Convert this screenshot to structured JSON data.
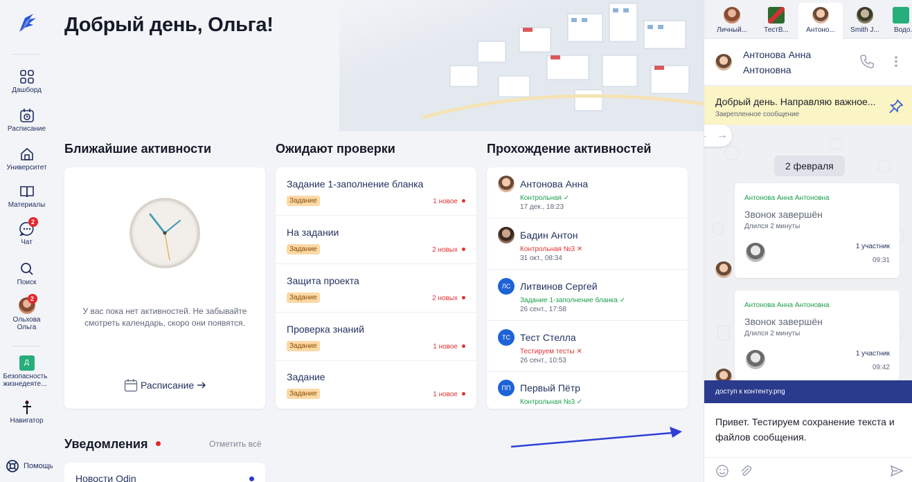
{
  "nav": {
    "items": [
      {
        "label": "Дашборд",
        "icon": "grid-icon"
      },
      {
        "label": "Расписание",
        "icon": "calendar-icon"
      },
      {
        "label": "Университет",
        "icon": "home-icon"
      },
      {
        "label": "Материалы",
        "icon": "book-icon"
      },
      {
        "label": "Чат",
        "icon": "chat-icon",
        "badge": "2"
      },
      {
        "label": "Поиск",
        "icon": "search-icon"
      },
      {
        "label": "Ольхова Ольга",
        "icon": "avatar",
        "badge": "2"
      },
      {
        "label": "Безопасность жизнедеяте...",
        "icon": "course-icon",
        "initial": "Д"
      },
      {
        "label": "Навигатор",
        "icon": "navigator-icon"
      }
    ],
    "help": "Помощь"
  },
  "greeting": "Добрый день, Ольга!",
  "activities": {
    "title": "Ближайшие активности",
    "empty": "У вас пока нет активностей. Не забывайте смотреть календарь, скоро они появятся.",
    "link": "Расписание"
  },
  "review": {
    "title": "Ожидают проверки",
    "items": [
      {
        "title": "Задание 1-заполнение бланка",
        "tag": "Задание",
        "count": "1 новое"
      },
      {
        "title": "На задании",
        "tag": "Задание",
        "count": "2 новых"
      },
      {
        "title": "Защита проекта",
        "tag": "Задание",
        "count": "2 новых"
      },
      {
        "title": "Проверка знаний",
        "tag": "Задание",
        "count": "1 новое"
      },
      {
        "title": "Задание",
        "tag": "Задание",
        "count": "1 новое"
      }
    ]
  },
  "progress": {
    "title": "Прохождение активностей",
    "items": [
      {
        "name": "Антонова Анна",
        "status": "Контрольная ✓",
        "state": "ok",
        "date": "17 дек., 18:23",
        "avatar": "photo"
      },
      {
        "name": "Бадин Антон",
        "status": "Контрольная №3 ✕",
        "state": "bad",
        "date": "31 окт., 08:34",
        "avatar": "photo2"
      },
      {
        "name": "Литвинов Сергей",
        "status": "Задание 1-заполнение бланка ✓",
        "state": "ok",
        "date": "26 сент., 17:58",
        "initials": "ЛС"
      },
      {
        "name": "Тест Стелла",
        "status": "Тестируем тесты ✕",
        "state": "bad",
        "date": "26 сент., 10:53",
        "initials": "ТС"
      },
      {
        "name": "Первый Пётр",
        "status": "Контрольная №3 ✓",
        "state": "ok",
        "date": "",
        "initials": "ПП"
      }
    ]
  },
  "notifications": {
    "title": "Уведомления",
    "mark_all": "Отметить всё",
    "items": [
      {
        "title": "Новости Odin"
      }
    ]
  },
  "chat": {
    "tabs": [
      {
        "label": "Личный..."
      },
      {
        "label": "ТестВ..."
      },
      {
        "label": "Антоно..."
      },
      {
        "label": "Smith J..."
      },
      {
        "label": "Водо..."
      }
    ],
    "contact": "Антонова Анна Антоновна",
    "pinned": {
      "text": "Добрый день. Направляю важное...",
      "sub": "Закрепленное сообщение"
    },
    "date": "2 февраля",
    "messages": [
      {
        "author": "Антонова Анна Антоновна",
        "title": "Звонок завершён",
        "sub": "Длился 2 минуты",
        "participants": "1 участник",
        "time": "09:31"
      },
      {
        "author": "Антонова Анна Антоновна",
        "title": "Звонок завершён",
        "sub": "Длился 2 минуты",
        "participants": "1 участник",
        "time": "09:42"
      }
    ],
    "attachment": "доступ к контенту.png",
    "composer_text": "Привет. Тестируем сохранение текста и файлов сообщения."
  },
  "colors": {
    "accent": "#24325f",
    "brand": "#2a3a8c",
    "danger": "#e03131",
    "success": "#1b9e4b",
    "pinned_bg": "#fbf4c4",
    "tag_bg": "#fcd9a6"
  }
}
